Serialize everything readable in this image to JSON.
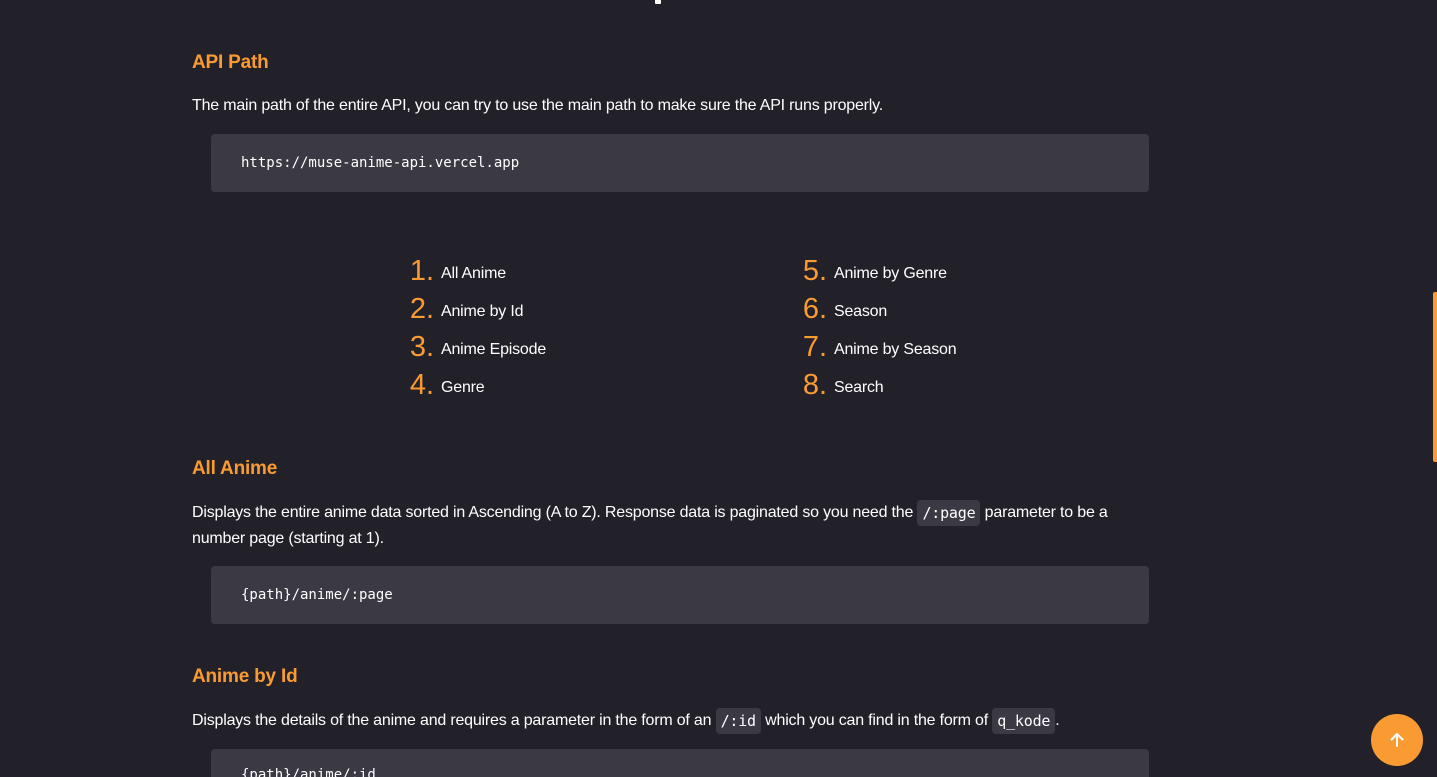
{
  "sections": {
    "api_path": {
      "title": "API Path",
      "description": "The main path of the entire API, you can try to use the main path to make sure the API runs properly.",
      "code": "https://muse-anime-api.vercel.app"
    },
    "all_anime": {
      "title": "All Anime",
      "description_before": "Displays the entire anime data sorted in Ascending (A to Z). Response data is paginated so you need the ",
      "param": "/:page",
      "description_after": " parameter to be a number page (starting at 1).",
      "code": "{path}/anime/:page"
    },
    "anime_by_id": {
      "title": "Anime by Id",
      "description_before": "Displays the details of the anime and requires a parameter in the form of an ",
      "param": "/:id",
      "description_middle": " which you can find in the form of ",
      "param2": "q_kode",
      "description_after": ".",
      "code": "{path}/anime/:id"
    }
  },
  "toc": [
    {
      "num": "1.",
      "label": "All Anime"
    },
    {
      "num": "2.",
      "label": "Anime by Id"
    },
    {
      "num": "3.",
      "label": "Anime Episode"
    },
    {
      "num": "4.",
      "label": "Genre"
    },
    {
      "num": "5.",
      "label": "Anime by Genre"
    },
    {
      "num": "6.",
      "label": "Season"
    },
    {
      "num": "7.",
      "label": "Anime by Season"
    },
    {
      "num": "8.",
      "label": "Search"
    }
  ],
  "back_to_top": {
    "icon": "arrow-up-icon"
  },
  "colors": {
    "background": "#222129",
    "accent": "#f99b32",
    "code_background": "#3b3a44",
    "text": "#ffffff"
  }
}
